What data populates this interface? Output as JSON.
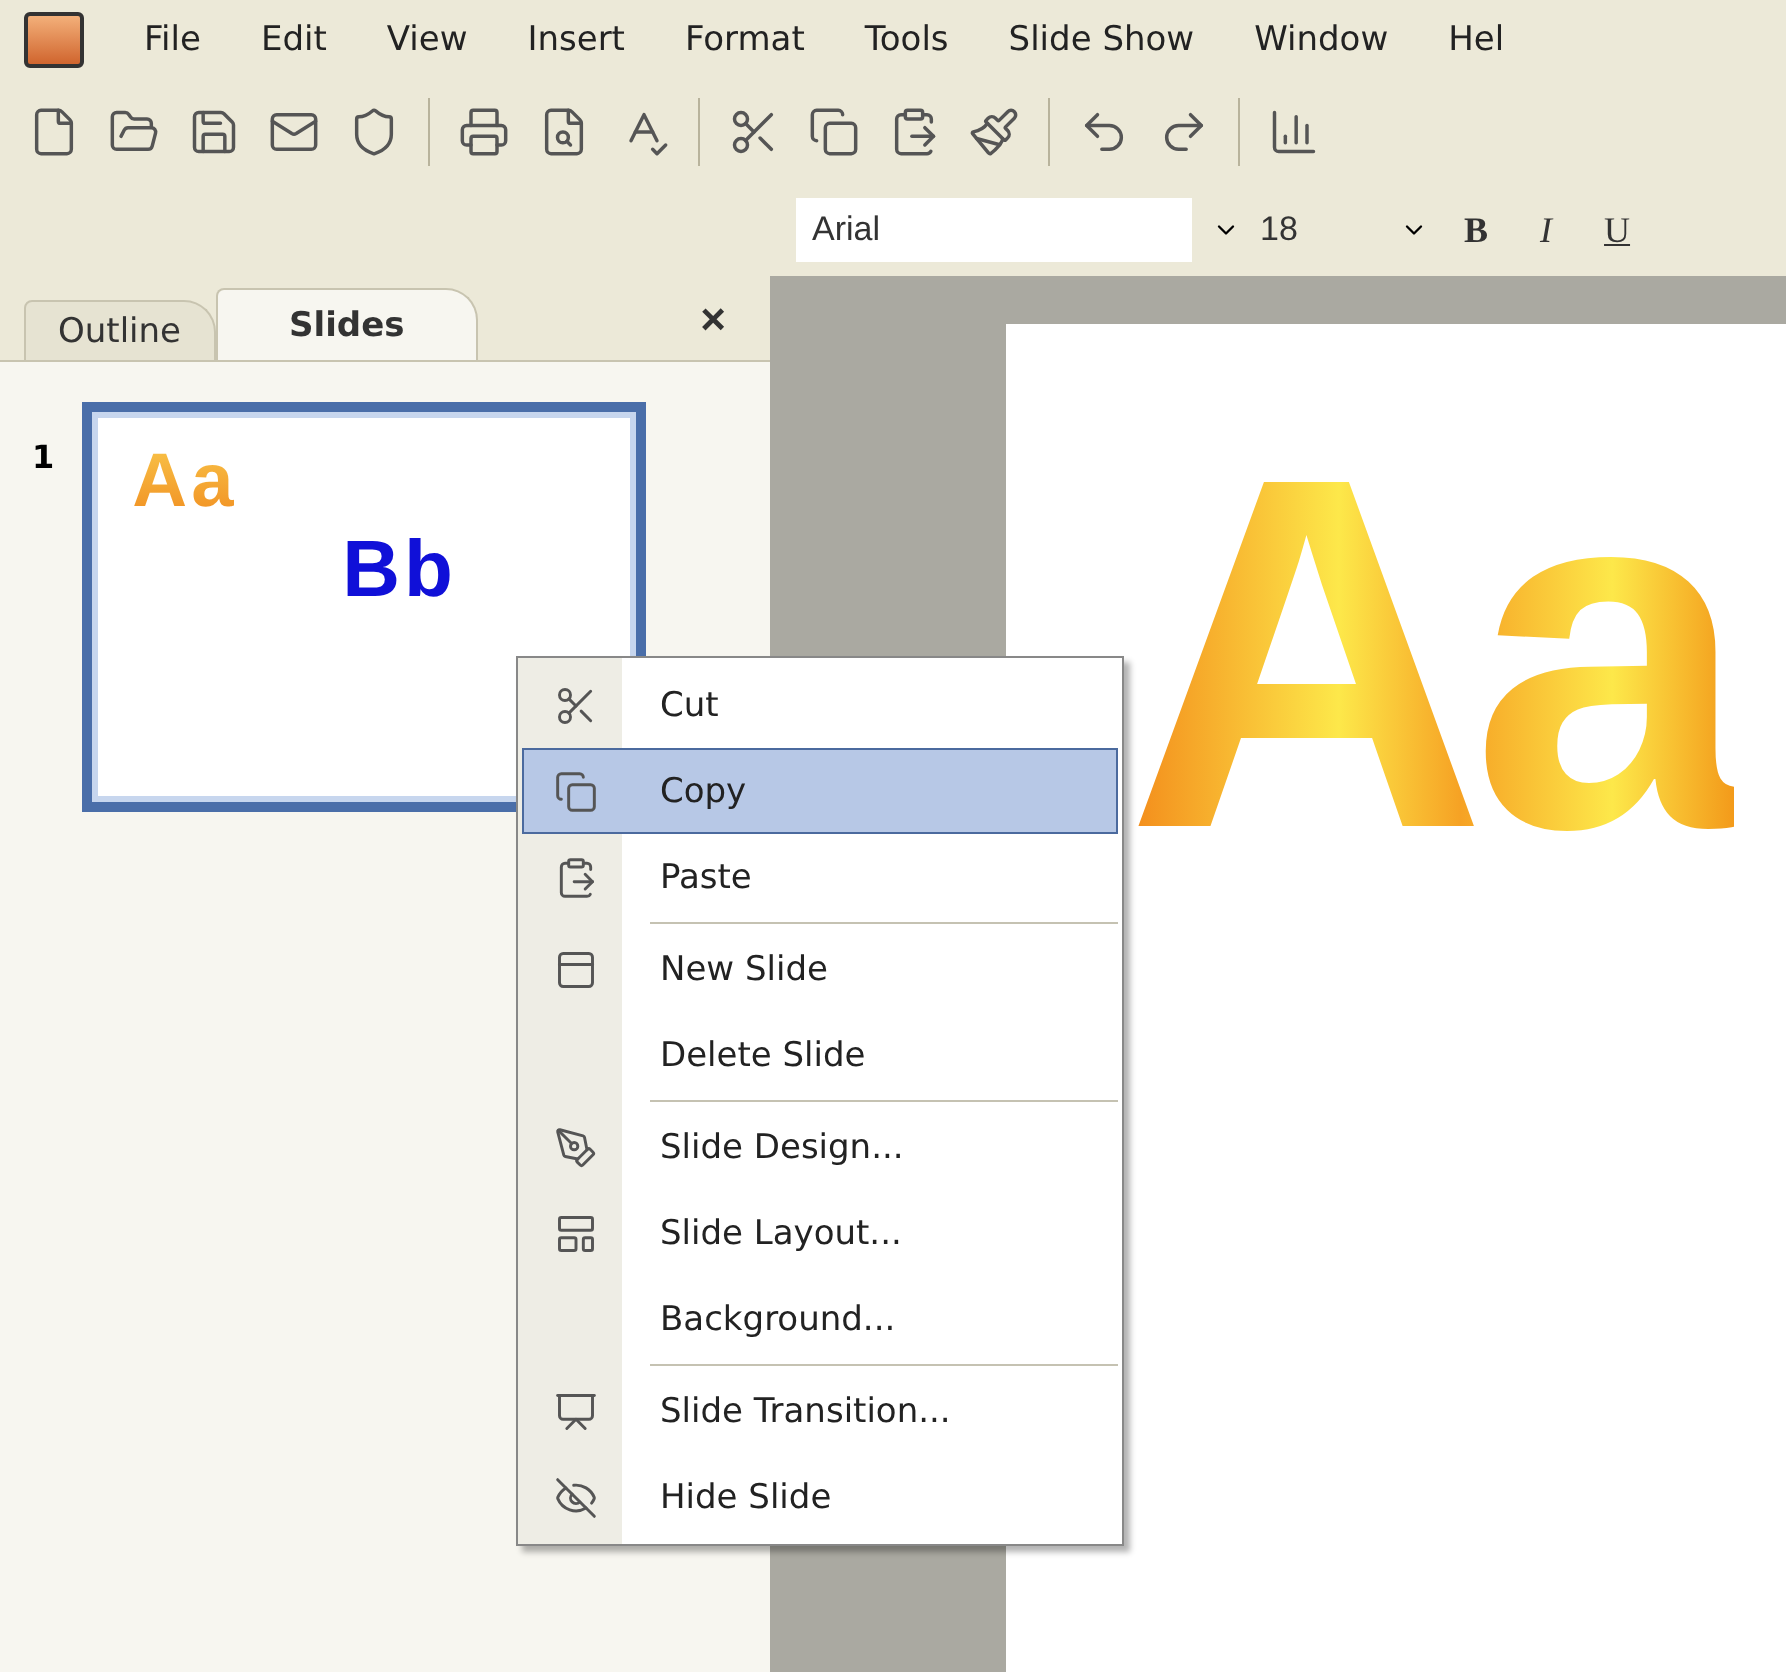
{
  "menu_bar": {
    "items": [
      "File",
      "Edit",
      "View",
      "Insert",
      "Format",
      "Tools",
      "Slide Show",
      "Window",
      "Hel"
    ]
  },
  "formatting_bar": {
    "font": "Arial",
    "size": "18",
    "style_buttons": [
      "B",
      "I",
      "U"
    ]
  },
  "pane": {
    "tabs": [
      {
        "label": "Outline",
        "selected": false
      },
      {
        "label": "Slides",
        "selected": true
      }
    ],
    "close": "×"
  },
  "slides": [
    {
      "number": "1",
      "selected": true,
      "title": "Aa",
      "subtitle": "Bb"
    }
  ],
  "slide": {
    "title": "Aa"
  },
  "context_menu": {
    "items": [
      {
        "kind": "item",
        "label": "Cut",
        "selected": false
      },
      {
        "kind": "item",
        "label": "Copy",
        "selected": true
      },
      {
        "kind": "item",
        "label": "Paste",
        "selected": false
      },
      {
        "kind": "separator"
      },
      {
        "kind": "item",
        "label": "New Slide",
        "selected": false
      },
      {
        "kind": "item",
        "label": "Delete Slide",
        "selected": false
      },
      {
        "kind": "separator"
      },
      {
        "kind": "item",
        "label": "Slide Design...",
        "selected": false
      },
      {
        "kind": "item",
        "label": "Slide Layout...",
        "selected": false
      },
      {
        "kind": "item",
        "label": "Background...",
        "selected": false
      },
      {
        "kind": "separator"
      },
      {
        "kind": "item",
        "label": "Slide Transition...",
        "selected": false
      },
      {
        "kind": "item",
        "label": "Hide Slide",
        "selected": false
      }
    ]
  }
}
